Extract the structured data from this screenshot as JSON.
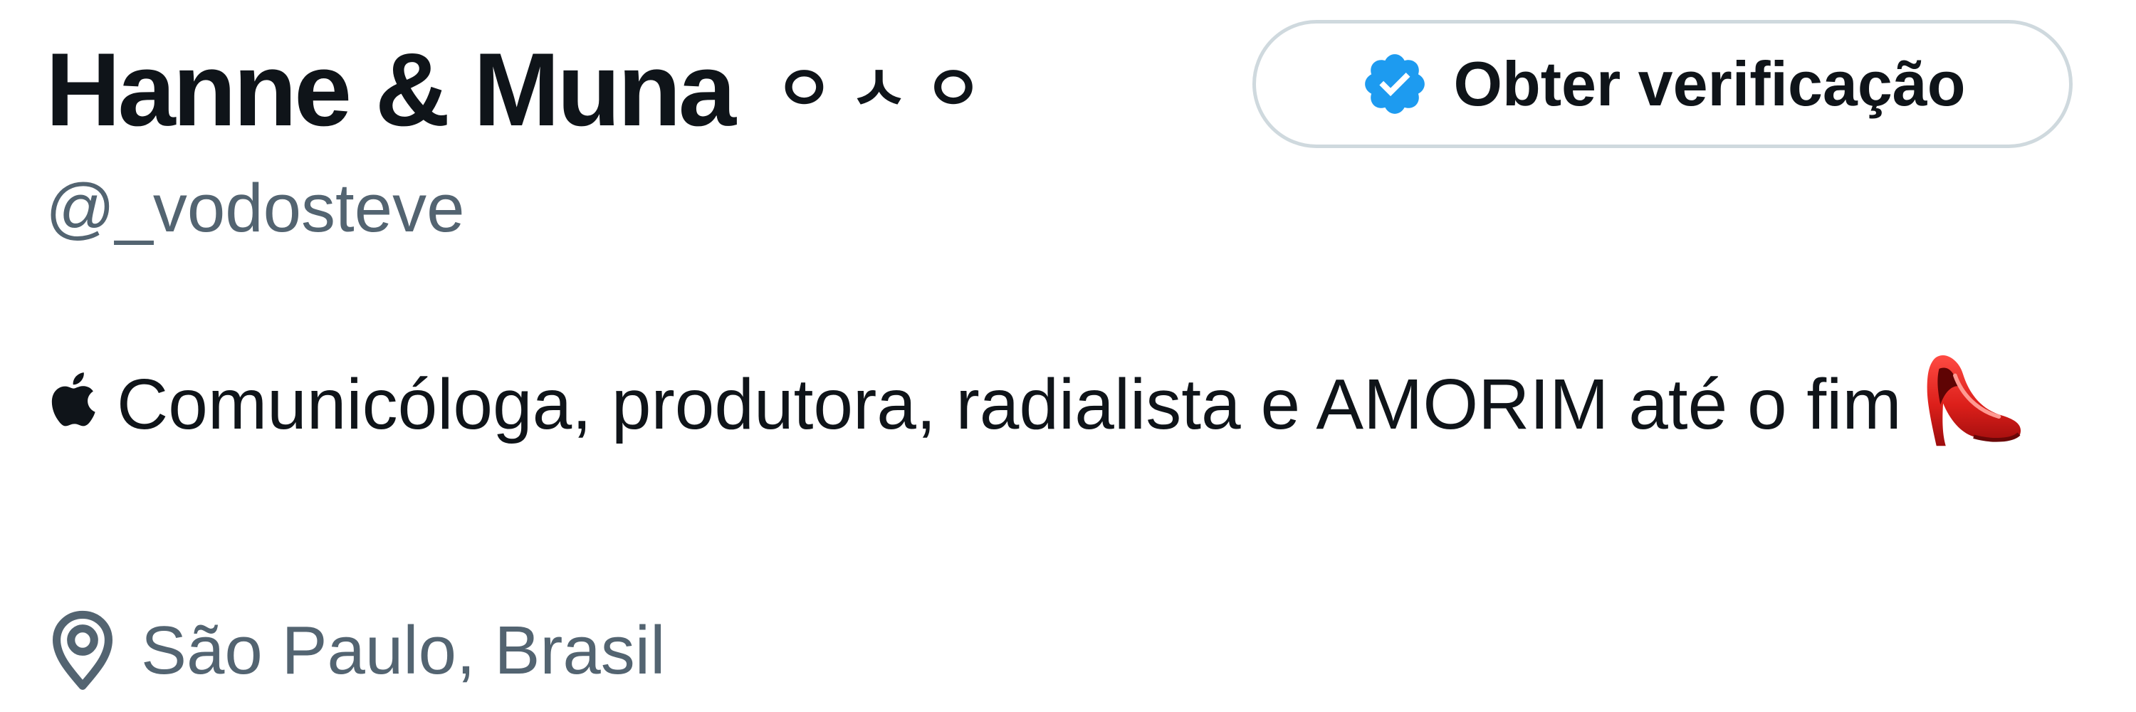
{
  "profile": {
    "display_name": "Hanne & Muna",
    "name_symbols": "ㅇㅅㅇ",
    "verify_button_label": "Obter verificação",
    "handle": "@_vodosteve",
    "bio_part1": "Comunicóloga, produtora, radialista e AMORIM até o fim",
    "bio_leading_icon": "apple-icon",
    "bio_trailing_icon": "high-heel-shoe-icon",
    "location": "São Paulo, Brasil",
    "location_icon": "location-pin-icon"
  },
  "colors": {
    "primary_text": "#0f1419",
    "secondary_text": "#536471",
    "verified_blue": "#1d9bf0",
    "button_border": "#cfd9de"
  }
}
